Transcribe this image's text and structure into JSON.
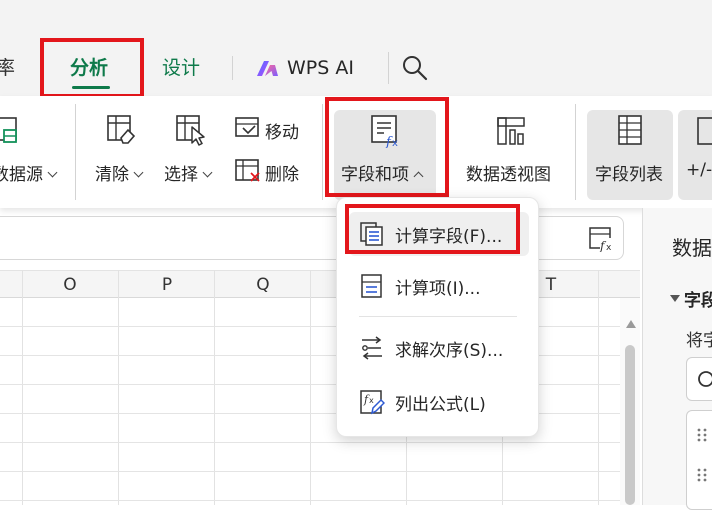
{
  "tabs": {
    "partial_left": "率",
    "analyze": "分析",
    "design": "设计",
    "wps_ai": "WPS AI"
  },
  "ribbon": {
    "data_source": "数据源",
    "clear": "清除",
    "select": "选择",
    "move": "移动",
    "delete": "删除",
    "fields_items": "字段和项",
    "pivot_chart": "数据透视图",
    "field_list": "字段列表",
    "plus_minus": "+/-"
  },
  "columns": [
    "O",
    "P",
    "Q",
    "T"
  ],
  "menu": {
    "items": [
      {
        "label": "计算字段(F)...",
        "icon": "calculated-field-icon"
      },
      {
        "label": "计算项(I)...",
        "icon": "calculated-item-icon"
      },
      {
        "label": "求解次序(S)...",
        "icon": "solve-order-icon"
      },
      {
        "label": "列出公式(L)",
        "icon": "list-formulas-icon"
      }
    ]
  },
  "panel": {
    "title": "数据",
    "section": "字段",
    "hint": "将字"
  },
  "colors": {
    "accent_green": "#0e7a4a",
    "highlight_red": "#e3161b",
    "icon_blue": "#2f5bd3"
  }
}
